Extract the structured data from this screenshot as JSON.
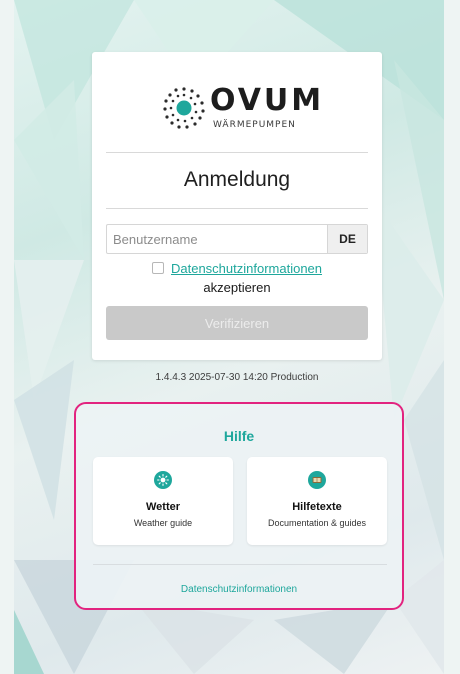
{
  "brand": {
    "name": "OVUM",
    "tagline": "WÄRMEPUMPEN",
    "accent_color": "#1ea79c",
    "logo_icon": "ovum-dotted-sun-logo"
  },
  "login": {
    "title": "Anmeldung",
    "username_placeholder": "Benutzername",
    "language_button": "DE",
    "privacy_link": "Datenschutzinformationen",
    "privacy_accept": "akzeptieren",
    "verify_button": "Verifizieren"
  },
  "version": "1.4.4.3 2025-07-30 14:20 Production",
  "help": {
    "title": "Hilfe",
    "highlight_color": "#e2237f",
    "tiles": [
      {
        "title": "Wetter",
        "subtitle": "Weather guide",
        "icon": "weather-sun-icon"
      },
      {
        "title": "Hilfetexte",
        "subtitle": "Documentation & guides",
        "icon": "help-book-icon"
      }
    ],
    "privacy_link": "Datenschutzinformationen"
  }
}
